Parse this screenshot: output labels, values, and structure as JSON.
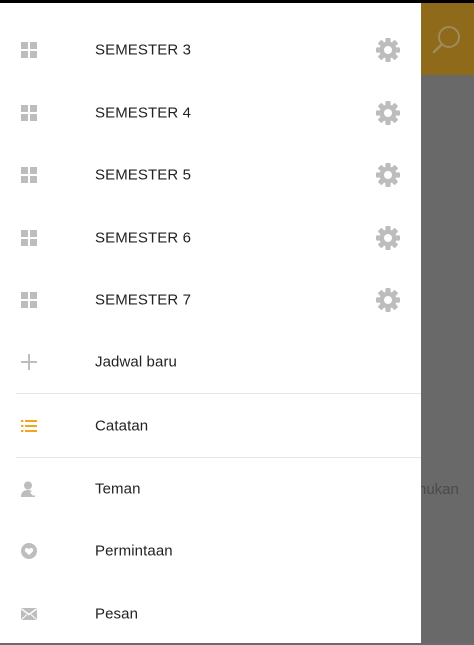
{
  "colors": {
    "icon_gray": "#bdbdbd",
    "accent_orange": "#f0a81a",
    "appbar": "#8f6a1a",
    "scrim": "#6b6b6b",
    "text": "#222222"
  },
  "background": {
    "partial_text": "nukan",
    "search_icon": "search-icon"
  },
  "drawer": {
    "semesters": [
      {
        "label": "SEMESTER 3",
        "icon": "grid-icon",
        "action_icon": "gear-icon"
      },
      {
        "label": "SEMESTER 4",
        "icon": "grid-icon",
        "action_icon": "gear-icon"
      },
      {
        "label": "SEMESTER 5",
        "icon": "grid-icon",
        "action_icon": "gear-icon"
      },
      {
        "label": "SEMESTER 6",
        "icon": "grid-icon",
        "action_icon": "gear-icon"
      },
      {
        "label": "SEMESTER 7",
        "icon": "grid-icon",
        "action_icon": "gear-icon"
      }
    ],
    "new_schedule": {
      "label": "Jadwal baru",
      "icon": "plus-icon"
    },
    "notes": {
      "label": "Catatan",
      "icon": "list-icon"
    },
    "friends": {
      "label": "Teman",
      "icon": "person-icon"
    },
    "requests": {
      "label": "Permintaan",
      "icon": "heart-icon"
    },
    "messages": {
      "label": "Pesan",
      "icon": "mail-icon"
    }
  }
}
